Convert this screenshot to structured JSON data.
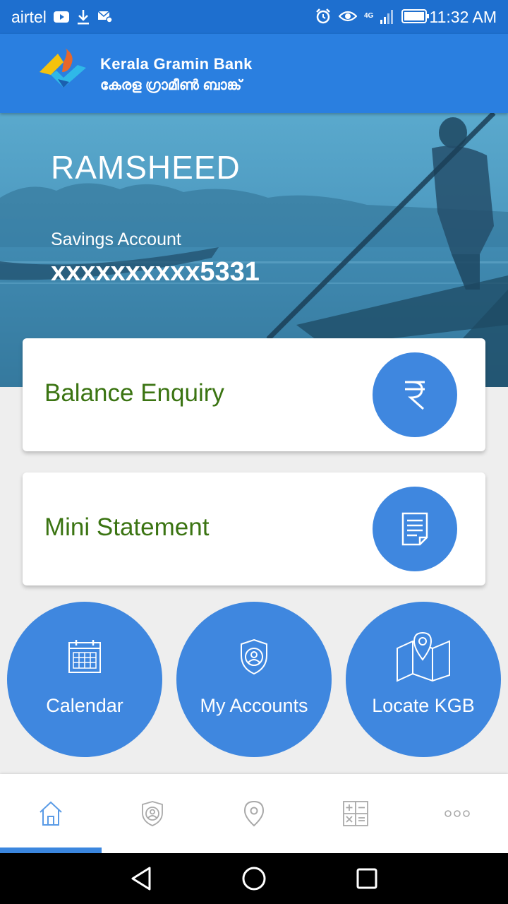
{
  "status_bar": {
    "carrier": "airtel",
    "network": "4G",
    "time": "11:32 AM"
  },
  "header": {
    "bank_name_en": "Kerala Gramin Bank",
    "bank_name_ml": "കേരള ഗ്രാമീൺ ബാങ്ക്"
  },
  "account": {
    "customer_name": "RAMSHEED",
    "account_type": "Savings Account",
    "account_number": "xxxxxxxxxx5331"
  },
  "actions": {
    "balance_label": "Balance Enquiry",
    "balance_icon": "rupee-icon",
    "mini_label": "Mini Statement",
    "mini_icon": "document-icon"
  },
  "shortcuts": [
    {
      "label": "Calendar",
      "icon": "calendar-icon"
    },
    {
      "label": "My Accounts",
      "icon": "shield-user-icon"
    },
    {
      "label": "Locate KGB",
      "icon": "map-pin-icon"
    }
  ],
  "bottom_nav": {
    "items": [
      "home-icon",
      "shield-user-icon",
      "location-pin-icon",
      "calculator-icon",
      "more-icon"
    ],
    "active_index": 0
  },
  "colors": {
    "primary": "#2a7fe0",
    "status_bar": "#1e6fcf",
    "circle": "#3f87df",
    "label_green": "#3b7412"
  }
}
